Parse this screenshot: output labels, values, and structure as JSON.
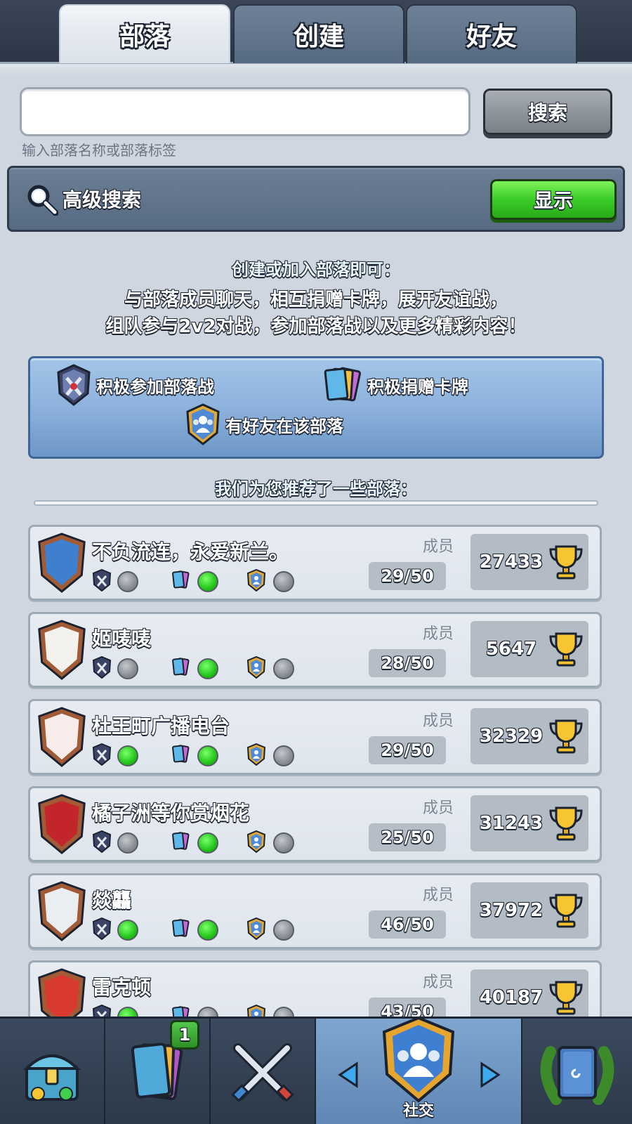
{
  "tabs": [
    {
      "label": "部落",
      "active": true
    },
    {
      "label": "创建",
      "active": false
    },
    {
      "label": "好友",
      "active": false
    }
  ],
  "search": {
    "value": "",
    "hint": "输入部落名称或部落标签",
    "button_label": "搜索"
  },
  "advanced": {
    "label": "高级搜索",
    "show_label": "显示"
  },
  "info": {
    "title": "创建或加入部落即可：",
    "line1": "与部落成员聊天，相互捐赠卡牌，展开友谊战，",
    "line2": "组队参与2v2对战，参加部落战以及更多精彩内容！"
  },
  "criteria": {
    "war": "积极参加部落战",
    "donate": "积极捐赠卡牌",
    "friends": "有好友在该部落"
  },
  "recommend_title": "我们为您推荐了一些部落：",
  "members_label": "成员",
  "clans": [
    {
      "name": "不负流连，永爱新兰。",
      "members": "29/50",
      "trophies": "27433",
      "war": false,
      "donate": true,
      "friends": false,
      "badge_color": "#3f7fcf",
      "badge_icon": "ninja-icon"
    },
    {
      "name": "姬唛唛",
      "members": "28/50",
      "trophies": "5647",
      "war": false,
      "donate": true,
      "friends": false,
      "badge_color": "#f4f2ee",
      "badge_icon": "red-cross-icon"
    },
    {
      "name": "杜王町广播电台",
      "members": "29/50",
      "trophies": "32329",
      "war": true,
      "donate": true,
      "friends": false,
      "badge_color": "#f8ecea",
      "badge_icon": "sakura-icon"
    },
    {
      "name": "橘子洲等你赏烟花",
      "members": "25/50",
      "trophies": "31243",
      "war": false,
      "donate": true,
      "friends": false,
      "badge_color": "#c3262a",
      "badge_icon": "flame-icon"
    },
    {
      "name": "燚龘",
      "members": "46/50",
      "trophies": "37972",
      "war": true,
      "donate": true,
      "friends": false,
      "badge_color": "#e9eef3",
      "badge_icon": "knight-helmet-icon"
    },
    {
      "name": "雷克顿",
      "members": "43/50",
      "trophies": "40187",
      "war": true,
      "donate": false,
      "friends": false,
      "badge_color": "#d93a2f",
      "badge_icon": "star-icon"
    }
  ],
  "nav": {
    "items": [
      {
        "icon": "chest-icon"
      },
      {
        "icon": "cards-icon",
        "badge": "1"
      },
      {
        "icon": "crossed-swords-icon"
      },
      {
        "icon": "social-icon",
        "label": "社交",
        "active": true
      },
      {
        "icon": "laurel-events-icon"
      }
    ]
  },
  "colors": {
    "accent_green": "#3bcc27",
    "panel_blue": "#8db2dc",
    "background": "#cfd6df"
  }
}
